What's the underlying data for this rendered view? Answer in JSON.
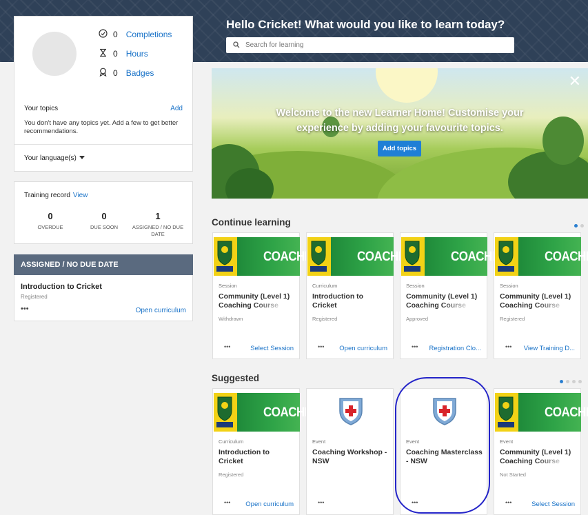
{
  "header": {
    "greeting": "Hello Cricket! What would you like to learn today?",
    "search_placeholder": "Search for learning"
  },
  "profile": {
    "completions_count": "0",
    "completions_label": "Completions",
    "hours_count": "0",
    "hours_label": "Hours",
    "badges_count": "0",
    "badges_label": "Badges",
    "topics_heading": "Your topics",
    "topics_add": "Add",
    "topics_text": "You don't have any topics yet. Add a few to get better recommendations.",
    "language_label": "Your language(s)"
  },
  "training": {
    "heading": "Training record",
    "view": "View",
    "stats": [
      {
        "value": "0",
        "label": "OVERDUE"
      },
      {
        "value": "0",
        "label": "DUE SOON"
      },
      {
        "value": "1",
        "label": "ASSIGNED / NO DUE DATE"
      }
    ]
  },
  "assigned": {
    "heading": "ASSIGNED / NO DUE DATE",
    "title": "Introduction to Cricket",
    "status": "Registered",
    "dots": "•••",
    "link": "Open curriculum"
  },
  "banner": {
    "text": "Welcome to the new Learner Home! Customise your experience by adding your favourite topics.",
    "button": "Add topics",
    "close": "✕"
  },
  "continue": {
    "heading": "Continue learning",
    "tiles": [
      {
        "thumb": "COACHING",
        "type": "Session",
        "title": "Community (Level 1)",
        "title2": "Coaching Course",
        "status": "Withdrawn",
        "dots": "•••",
        "link": "Select Session"
      },
      {
        "thumb": "COACHING",
        "type": "Curriculum",
        "title": "Introduction to",
        "title2": "Cricket",
        "status": "Registered",
        "dots": "•••",
        "link": "Open curriculum"
      },
      {
        "thumb": "COACHING",
        "type": "Session",
        "title": "Community (Level 1)",
        "title2": "Coaching Course",
        "status": "Approved",
        "dots": "•••",
        "link": "Registration Clo..."
      },
      {
        "thumb": "COACHING",
        "type": "Session",
        "title": "Community (Level 1)",
        "title2": "Coaching Course",
        "status": "Registered",
        "dots": "•••",
        "link": "View Training D..."
      }
    ]
  },
  "suggested": {
    "heading": "Suggested",
    "tiles": [
      {
        "thumb": "COACHING",
        "type": "Curriculum",
        "title": "Introduction to",
        "title2": "Cricket",
        "status": "Registered",
        "dots": "•••",
        "link": "Open curriculum"
      },
      {
        "type": "Event",
        "title": "Coaching Workshop -",
        "title2": "NSW",
        "dots": "•••"
      },
      {
        "type": "Event",
        "title": "Coaching Masterclass",
        "title2": "- NSW",
        "dots": "•••"
      },
      {
        "thumb": "COACHING",
        "type": "Event",
        "title": "Community (Level 1)",
        "title2": "Coaching Course",
        "status": "Not Started",
        "dots": "•••",
        "link": "Select Session"
      }
    ]
  },
  "colors": {
    "header_band": "#2f4158",
    "link_blue": "#1a73c8",
    "assigned_bar": "#5a6a7f",
    "coaching_green": "#2ea347",
    "annotation_circle": "#2424c8"
  }
}
